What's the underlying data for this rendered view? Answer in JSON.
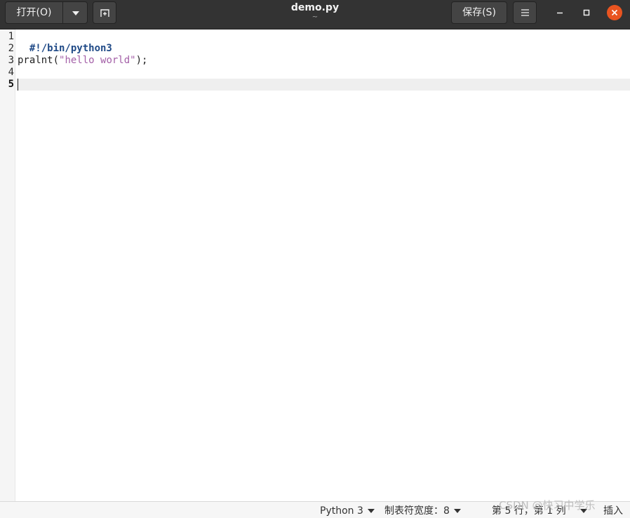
{
  "header": {
    "open_label": "打开(O)",
    "save_label": "保存(S)",
    "title": "demo.py",
    "subtitle": "~",
    "open_menu_icon": "chevron-down-icon",
    "new_tab_icon": "new-tab-icon",
    "menu_icon": "hamburger-icon",
    "window_controls": [
      "minimize-icon",
      "maximize-icon",
      "close-icon"
    ],
    "close_color": "#e95420"
  },
  "editor": {
    "line_numbers": [
      "1",
      "2",
      "3",
      "4",
      "5"
    ],
    "current_line": 5,
    "lines": [
      {
        "parts": [
          {
            "text": "#!/bin/python3",
            "kind": "shebang"
          }
        ]
      },
      {
        "parts": []
      },
      {
        "parts": [
          {
            "text": "pralnt(",
            "kind": "plain"
          },
          {
            "text": "\"hello world\"",
            "kind": "string"
          },
          {
            "text": ");",
            "kind": "plain"
          }
        ]
      },
      {
        "parts": []
      },
      {
        "parts": []
      }
    ],
    "colors": {
      "shebang": "#204a87",
      "string": "#a35fa7"
    }
  },
  "statusbar": {
    "language": "Python 3",
    "tab_width": "制表符宽度：8",
    "position": "第 5 行，第 1 列",
    "mode": "插入"
  },
  "watermark": "CSDN @快习中学乐"
}
